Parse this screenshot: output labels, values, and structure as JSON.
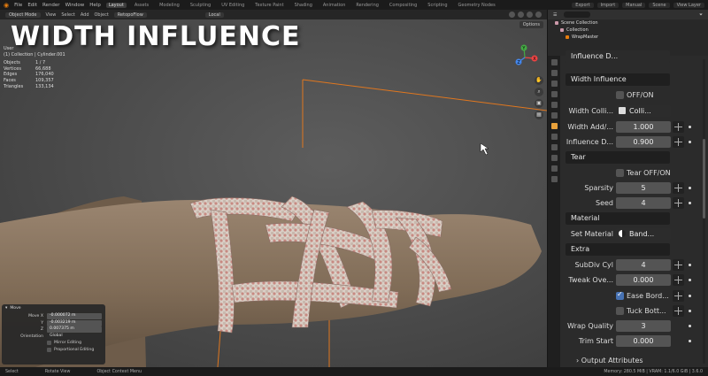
{
  "topbar": {
    "menus": [
      "File",
      "Edit",
      "Render",
      "Window",
      "Help"
    ],
    "workspaces": [
      "Layout",
      "Assets",
      "Modeling",
      "Sculpting",
      "UV Editing",
      "Texture Paint",
      "Shading",
      "Animation",
      "Rendering",
      "Compositing",
      "Scripting",
      "Geometry Nodes"
    ],
    "buttons": [
      "Export",
      "Import",
      "Manual"
    ],
    "scene": "Scene",
    "view_layer": "View Layer"
  },
  "viewport_header": {
    "mode": "Object Mode",
    "menus": [
      "View",
      "Select",
      "Add",
      "Object",
      "RetopoFlow"
    ],
    "transform": "Local",
    "options": "Options"
  },
  "overlay_title": "WIDTH INFLUENCE",
  "stats": {
    "view": "User",
    "context": "(1) Collection | Cylinder.001",
    "rows": [
      {
        "k": "Objects",
        "v": "1 / 7"
      },
      {
        "k": "Vertices",
        "v": "66,688"
      },
      {
        "k": "Edges",
        "v": "176,040"
      },
      {
        "k": "Faces",
        "v": "109,357"
      },
      {
        "k": "Triangles",
        "v": "133,134"
      }
    ]
  },
  "gizmo": {
    "x": "X",
    "y": "Y",
    "z": "Z"
  },
  "operator_panel": {
    "title": "Move",
    "move_x_label": "Move X",
    "move_x": "-0.000072 m",
    "y_label": "Y",
    "y": "-0.003219 m",
    "z_label": "Z",
    "z": "0.007375 m",
    "orientation_label": "Orientation",
    "orientation": "Global",
    "mirror_editing": "Mirror Editing",
    "proportional_editing": "Proportional Editing"
  },
  "statusbar": {
    "select": "Select",
    "rotate": "Rotate View",
    "context_menu": "Object Context Menu",
    "memory": "Memory: 280.5 MiB | VRAM: 1.1/6.0 GiB | 3.6.0"
  },
  "outliner": {
    "title": "Scene Collection",
    "items": [
      "Collection",
      "WrapMaster"
    ]
  },
  "properties": {
    "top_cut": "Influence D...",
    "sections": {
      "width_influence": "Width Influence",
      "tear": "Tear",
      "material": "Material",
      "extra": "Extra",
      "output_attributes": "Output Attributes"
    },
    "off_on_label": "OFF/ON",
    "width_collision_label": "Width Colli...",
    "width_collision_value": "Colli...",
    "width_add_label": "Width Add/...",
    "width_add_value": "1.000",
    "influence_d_label": "Influence D...",
    "influence_d_value": "0.900",
    "tear_off_on_label": "Tear OFF/ON",
    "sparsity_label": "Sparsity",
    "sparsity_value": "5",
    "seed_label": "Seed",
    "seed_value": "4",
    "set_material_label": "Set Material",
    "set_material_value": "Band...",
    "subdiv_label": "SubDiv Cyl",
    "subdiv_value": "4",
    "tweak_label": "Tweak Ove...",
    "tweak_value": "0.000",
    "ease_border_label": "Ease Bord...",
    "tuck_label": "Tuck Bott...",
    "wrap_quality_label": "Wrap Quality",
    "wrap_quality_value": "3",
    "trim_start_label": "Trim Start",
    "trim_start_value": "0.000"
  },
  "colors": {
    "accent_orange": "#e87d0d",
    "checkbox_blue": "#4772b3",
    "bandage_red": "#b8514a",
    "skin": "#8c7660"
  }
}
